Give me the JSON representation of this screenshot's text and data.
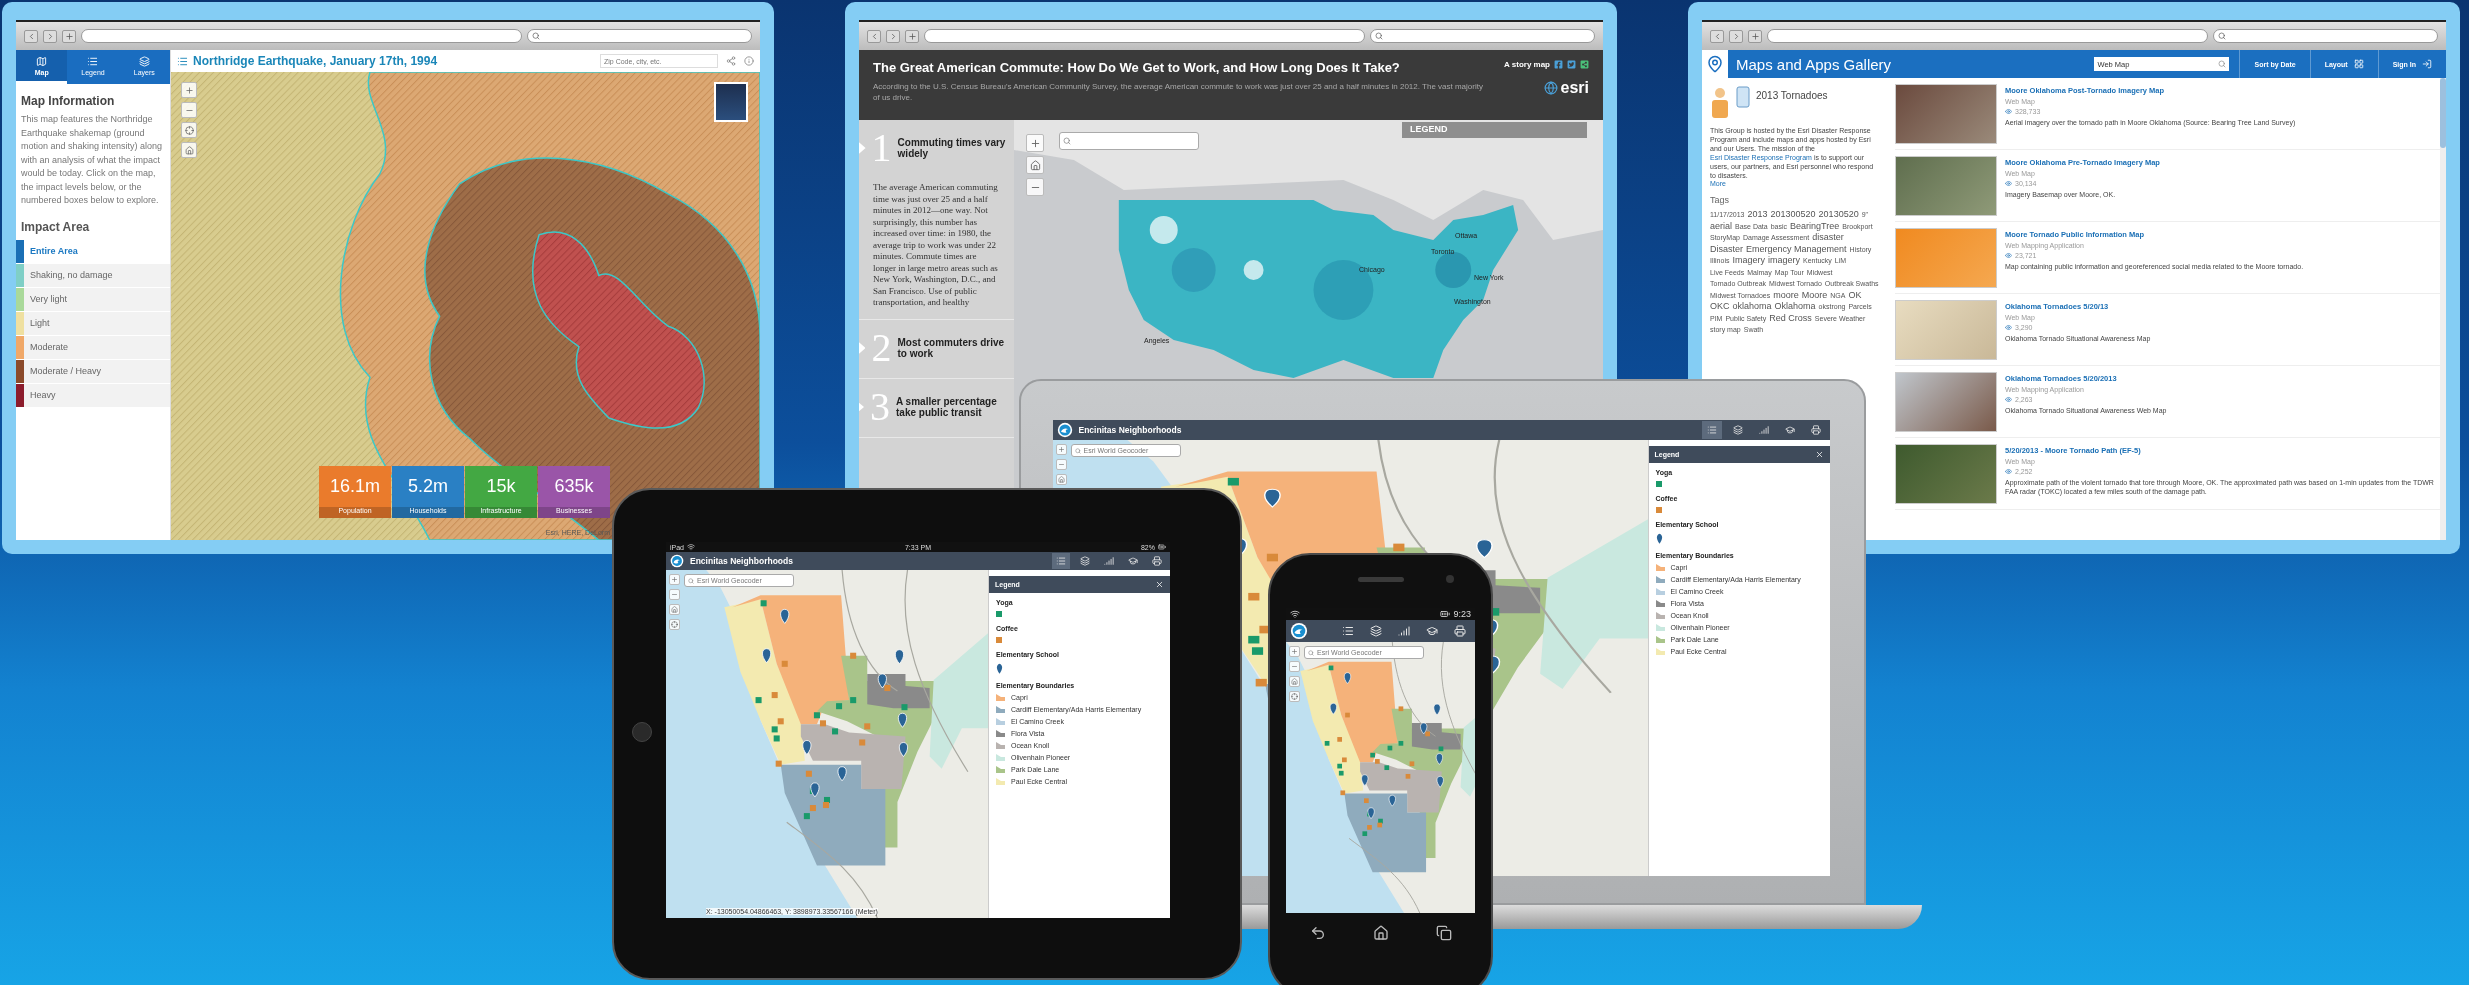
{
  "windows": [
    {
      "kind": "earthquake",
      "tabs": [
        {
          "label": "Map",
          "kind": "map",
          "selected": true
        },
        {
          "label": "Legend",
          "kind": "legend",
          "selected": false
        },
        {
          "label": "Layers",
          "kind": "layers",
          "selected": false
        }
      ],
      "title": "Northridge Earthquake, January 17th, 1994",
      "search_placeholder": "Zip Code, city, etc.",
      "info_heading": "Map Information",
      "info_text": "This map features the Northridge Earthquake shakemap (ground motion and shaking intensity) along with an analysis of what the impact would be today. Click on the map, the impact levels below, or the numbered boxes below to explore.",
      "impact_heading": "Impact Area",
      "impact_levels": [
        {
          "label": "Entire Area",
          "color": "#1a6fb5",
          "selected": true
        },
        {
          "label": "Shaking, no damage",
          "color": "#7fcfc6",
          "selected": false
        },
        {
          "label": "Very light",
          "color": "#a9d99a",
          "selected": false
        },
        {
          "label": "Light",
          "color": "#efe0a0",
          "selected": false
        },
        {
          "label": "Moderate",
          "color": "#f0a868",
          "selected": false
        },
        {
          "label": "Moderate / Heavy",
          "color": "#8b4a2a",
          "selected": false
        },
        {
          "label": "Heavy",
          "color": "#8c1c2c",
          "selected": false
        }
      ],
      "stats": [
        {
          "value": "16.1m",
          "label": "Population",
          "color": "#ea7b2c"
        },
        {
          "value": "5.2m",
          "label": "Households",
          "color": "#2a80c4"
        },
        {
          "value": "15k",
          "label": "Infrastructure",
          "color": "#43a843"
        },
        {
          "value": "635k",
          "label": "Businesses",
          "color": "#9a55a8"
        }
      ],
      "attribution": "Esri, HERE, DeLorm"
    },
    {
      "kind": "story",
      "title": "The Great American Commute: How Do We Get to Work, and How Long Does It Take?",
      "subtitle": "According to the U.S. Census Bureau's American Community Survey, the average American commute to work was just over 25 and a half minutes in 2012. The vast majority of us drive.",
      "byline": "A story map",
      "logo": "esri",
      "sections": [
        {
          "number": "1",
          "heading": "Commuting times vary widely",
          "body": "The average American commuting time was just over 25 and a half minutes in 2012—one way. Not surprisingly, this number has increased over time: in 1980, the average trip to work was under 22 minutes. Commute times are longer in large metro areas such as New York, Washington, D.C., and San Francisco. Use of public transportation, and healthy"
        },
        {
          "number": "2",
          "heading": "Most commuters drive to work"
        },
        {
          "number": "3",
          "heading": "A smaller percentage take public transit"
        }
      ],
      "legend_label": "LEGEND",
      "map_labels": [
        "Ottawa",
        "Toronto",
        "Chicago",
        "New York",
        "Washington",
        "Angeles"
      ]
    },
    {
      "kind": "gallery",
      "title": "Maps and Apps Gallery",
      "search_value": "Web Map",
      "sort_label": "Sort by Date",
      "layout_label": "Layout",
      "sign_in_label": "Sign In",
      "group_title": "2013 Tornadoes",
      "group_text": {
        "before": "This Group is hosted by the Esri Disaster Response Program and include maps and apps hosted by Esri and our Users. The mission of the ",
        "link": "Esri Disaster Response Program",
        "after": " is to support our users, our partners, and Esri personnel who respond to disasters."
      },
      "more_label": "More",
      "tags_heading": "Tags",
      "tags": [
        {
          "text": "11/17/2013",
          "kind": "small"
        },
        {
          "text": "2013",
          "kind": "large"
        },
        {
          "text": "201300520",
          "kind": "large"
        },
        {
          "text": "20130520",
          "kind": "large"
        },
        {
          "text": "9\"",
          "kind": "small"
        },
        {
          "text": "aerial",
          "kind": "large"
        },
        {
          "text": "Base Data",
          "kind": "small"
        },
        {
          "text": "basic",
          "kind": "small"
        },
        {
          "text": "BearingTree",
          "kind": "large"
        },
        {
          "text": "Brookport",
          "kind": "small"
        },
        {
          "text": "StoryMap",
          "kind": "small"
        },
        {
          "text": "Damage Assessment",
          "kind": "small"
        },
        {
          "text": "disaster",
          "kind": "large"
        },
        {
          "text": "Disaster",
          "kind": "large"
        },
        {
          "text": "Emergency Management",
          "kind": "large"
        },
        {
          "text": "History",
          "kind": "small"
        },
        {
          "text": "Illinois",
          "kind": "small"
        },
        {
          "text": "Imagery",
          "kind": "large"
        },
        {
          "text": "imagery",
          "kind": "large"
        },
        {
          "text": "Kentucky",
          "kind": "small"
        },
        {
          "text": "LiM",
          "kind": "small"
        },
        {
          "text": "Live Feeds",
          "kind": "small"
        },
        {
          "text": "Malmay",
          "kind": "small"
        },
        {
          "text": "Map Tour",
          "kind": "small"
        },
        {
          "text": "Midwest",
          "kind": "small"
        },
        {
          "text": "Tornado Outbreak",
          "kind": "small"
        },
        {
          "text": "Midwest Tornado",
          "kind": "small"
        },
        {
          "text": "Outbreak Swaths",
          "kind": "small"
        },
        {
          "text": "Midwest Tornadoes",
          "kind": "small"
        },
        {
          "text": "moore",
          "kind": "large"
        },
        {
          "text": "Moore",
          "kind": "large"
        },
        {
          "text": "NGA",
          "kind": "small"
        },
        {
          "text": "OK",
          "kind": "large"
        },
        {
          "text": "OKC",
          "kind": "large"
        },
        {
          "text": "oklahoma",
          "kind": "large"
        },
        {
          "text": "Oklahoma",
          "kind": "large"
        },
        {
          "text": "okstrong",
          "kind": "small"
        },
        {
          "text": "Parcels",
          "kind": "small"
        },
        {
          "text": "PIM",
          "kind": "small"
        },
        {
          "text": "Public Safety",
          "kind": "small"
        },
        {
          "text": "Red Cross",
          "kind": "large"
        },
        {
          "text": "Severe Weather",
          "kind": "small"
        },
        {
          "text": "story map",
          "kind": "small"
        },
        {
          "text": "Swath",
          "kind": "small"
        }
      ],
      "items": [
        {
          "title": "Moore Oklahoma Post-Tornado Imagery Map",
          "type": "Web Map",
          "views": "328,733",
          "description": "Aerial imagery over the tornado path in Moore Oklahoma (Source: Bearing Tree Land Survey)"
        },
        {
          "title": "Moore Oklahoma Pre-Tornado Imagery Map",
          "type": "Web Map",
          "views": "30,134",
          "description": "Imagery Basemap over Moore, OK."
        },
        {
          "title": "Moore Tornado Public Information Map",
          "type": "Web Mapping Application",
          "views": "23,721",
          "description": "Map containing public information and georeferenced social media related to the Moore tornado."
        },
        {
          "title": "Oklahoma Tornadoes 5/20/13",
          "type": "Web Map",
          "views": "3,290",
          "description": "Oklahoma Tornado Situational Awareness Map"
        },
        {
          "title": "Oklahoma Tornadoes 5/20/2013",
          "type": "Web Mapping Application",
          "views": "2,263",
          "description": "Oklahoma Tornado Situational Awareness Web Map"
        },
        {
          "title": "5/20/2013 - Moore Tornado Path (EF-5)",
          "type": "Web Map",
          "views": "2,252",
          "description": "Approximate path of the violent tornado that tore through Moore, OK. The approximated path was based on 1-min updates from the TDWR FAA radar (TOKC) located a few miles south of the damage path."
        }
      ]
    }
  ],
  "devices": [
    {
      "kind": "laptop",
      "app": {
        "title": "Encinitas Neighborhoods",
        "search_placeholder": "Esri World Geocoder",
        "tools": [
          {
            "kind": "legend",
            "selected": true
          },
          {
            "kind": "basemap",
            "selected": false
          },
          {
            "kind": "chart",
            "selected": false
          },
          {
            "kind": "education",
            "selected": false
          },
          {
            "kind": "print",
            "selected": false
          }
        ],
        "legend": {
          "title": "Legend",
          "groups": [
            {
              "heading": "Yoga",
              "items": [
                {
                  "kind": "square",
                  "color": "#1a9a6a"
                }
              ]
            },
            {
              "heading": "Coffee",
              "items": [
                {
                  "kind": "square",
                  "color": "#d98a3a"
                }
              ]
            },
            {
              "heading": "Elementary School",
              "items": [
                {
                  "kind": "pin",
                  "color": "#2a6496"
                }
              ]
            },
            {
              "heading": "Elementary Boundaries",
              "items": [
                {
                  "kind": "area",
                  "color": "#f5b27a",
                  "label": "Capri"
                },
                {
                  "kind": "area",
                  "color": "#8fabbd",
                  "label": "Cardiff Elementary/Ada Harris Elementary"
                },
                {
                  "kind": "area",
                  "color": "#b8cfe0",
                  "label": "El Camino Creek"
                },
                {
                  "kind": "area",
                  "color": "#8a8a8a",
                  "label": "Flora Vista"
                },
                {
                  "kind": "area",
                  "color": "#b9b3b0",
                  "label": "Ocean Knoll"
                },
                {
                  "kind": "area",
                  "color": "#c9e8df",
                  "label": "Olivenhain Pioneer"
                },
                {
                  "kind": "area",
                  "color": "#a9c48a",
                  "label": "Park Dale Lane"
                },
                {
                  "kind": "area",
                  "color": "#f3eab0",
                  "label": "Paul Ecke Central"
                }
              ]
            }
          ]
        }
      }
    },
    {
      "kind": "tablet",
      "status": {
        "device": "iPad",
        "time": "7:33 PM",
        "battery": "82%"
      },
      "app": {
        "title": "Encinitas Neighborhoods",
        "search_placeholder": "Esri World Geocoder",
        "tools": [
          {
            "kind": "legend",
            "selected": true
          },
          {
            "kind": "basemap",
            "selected": false
          },
          {
            "kind": "chart",
            "selected": false
          },
          {
            "kind": "education",
            "selected": false
          },
          {
            "kind": "print",
            "selected": false
          }
        ],
        "legend": {
          "title": "Legend",
          "groups": [
            {
              "heading": "Yoga",
              "items": [
                {
                  "kind": "square",
                  "color": "#1a9a6a"
                }
              ]
            },
            {
              "heading": "Coffee",
              "items": [
                {
                  "kind": "square",
                  "color": "#d98a3a"
                }
              ]
            },
            {
              "heading": "Elementary School",
              "items": [
                {
                  "kind": "pin",
                  "color": "#2a6496"
                }
              ]
            },
            {
              "heading": "Elementary Boundaries",
              "items": [
                {
                  "kind": "area",
                  "color": "#f5b27a",
                  "label": "Capri"
                },
                {
                  "kind": "area",
                  "color": "#8fabbd",
                  "label": "Cardiff Elementary/Ada Harris Elementary"
                },
                {
                  "kind": "area",
                  "color": "#b8cfe0",
                  "label": "El Camino Creek"
                },
                {
                  "kind": "area",
                  "color": "#8a8a8a",
                  "label": "Flora Vista"
                },
                {
                  "kind": "area",
                  "color": "#b9b3b0",
                  "label": "Ocean Knoll"
                },
                {
                  "kind": "area",
                  "color": "#c9e8df",
                  "label": "Olivenhain Pioneer"
                },
                {
                  "kind": "area",
                  "color": "#a9c48a",
                  "label": "Park Dale Lane"
                },
                {
                  "kind": "area",
                  "color": "#f3eab0",
                  "label": "Paul Ecke Central"
                }
              ]
            }
          ]
        },
        "coordinates": "X: -13050054.04866463, Y: 3898973.33567166 (Meter)"
      }
    },
    {
      "kind": "phone",
      "status": {
        "time": "9:23"
      },
      "app": {
        "search_placeholder": "Esri World Geocoder",
        "tools": [
          {
            "kind": "legend",
            "selected": false
          },
          {
            "kind": "basemap",
            "selected": false
          },
          {
            "kind": "chart",
            "selected": false
          },
          {
            "kind": "education",
            "selected": false
          },
          {
            "kind": "print",
            "selected": false
          }
        ]
      }
    }
  ]
}
